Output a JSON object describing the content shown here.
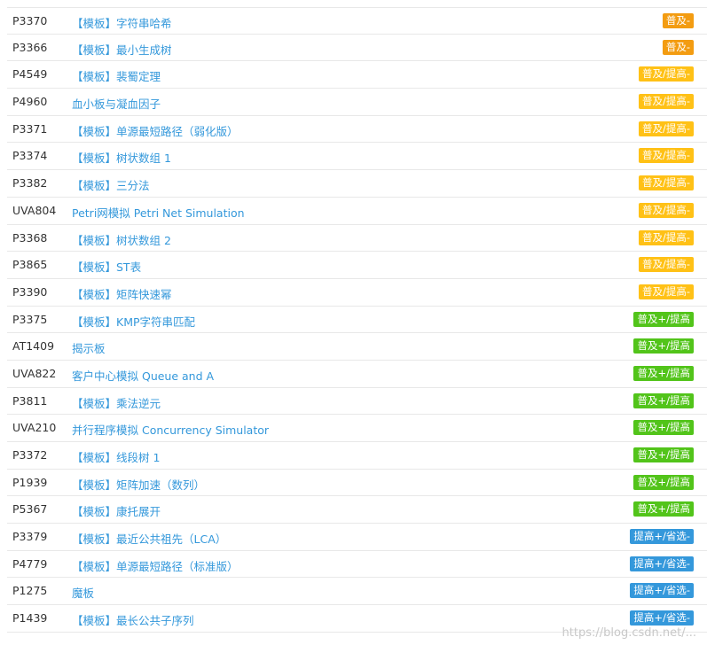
{
  "colors": {
    "level_orange": "#f39c11",
    "level_yellow": "#ffc116",
    "level_green": "#52c41a",
    "level_blue": "#3498db",
    "link": "#3498db"
  },
  "problems": [
    {
      "id": "P3370",
      "title": "【模板】字符串哈希",
      "level": "普及-",
      "color": "#f39c11"
    },
    {
      "id": "P3366",
      "title": "【模板】最小生成树",
      "level": "普及-",
      "color": "#f39c11"
    },
    {
      "id": "P4549",
      "title": "【模板】裴蜀定理",
      "level": "普及/提高-",
      "color": "#ffc116"
    },
    {
      "id": "P4960",
      "title": "血小板与凝血因子",
      "level": "普及/提高-",
      "color": "#ffc116"
    },
    {
      "id": "P3371",
      "title": "【模板】单源最短路径（弱化版）",
      "level": "普及/提高-",
      "color": "#ffc116"
    },
    {
      "id": "P3374",
      "title": "【模板】树状数组 1",
      "level": "普及/提高-",
      "color": "#ffc116"
    },
    {
      "id": "P3382",
      "title": "【模板】三分法",
      "level": "普及/提高-",
      "color": "#ffc116"
    },
    {
      "id": "UVA804",
      "title": "Petri网模拟 Petri Net Simulation",
      "level": "普及/提高-",
      "color": "#ffc116"
    },
    {
      "id": "P3368",
      "title": "【模板】树状数组 2",
      "level": "普及/提高-",
      "color": "#ffc116"
    },
    {
      "id": "P3865",
      "title": "【模板】ST表",
      "level": "普及/提高-",
      "color": "#ffc116"
    },
    {
      "id": "P3390",
      "title": "【模板】矩阵快速幂",
      "level": "普及/提高-",
      "color": "#ffc116"
    },
    {
      "id": "P3375",
      "title": "【模板】KMP字符串匹配",
      "level": "普及+/提高",
      "color": "#52c41a"
    },
    {
      "id": "AT1409",
      "title": "揭示板",
      "level": "普及+/提高",
      "color": "#52c41a"
    },
    {
      "id": "UVA822",
      "title": "客户中心模拟 Queue and A",
      "level": "普及+/提高",
      "color": "#52c41a"
    },
    {
      "id": "P3811",
      "title": "【模板】乘法逆元",
      "level": "普及+/提高",
      "color": "#52c41a"
    },
    {
      "id": "UVA210",
      "title": "并行程序模拟 Concurrency Simulator",
      "level": "普及+/提高",
      "color": "#52c41a"
    },
    {
      "id": "P3372",
      "title": "【模板】线段树 1",
      "level": "普及+/提高",
      "color": "#52c41a"
    },
    {
      "id": "P1939",
      "title": "【模板】矩阵加速（数列）",
      "level": "普及+/提高",
      "color": "#52c41a"
    },
    {
      "id": "P5367",
      "title": "【模板】康托展开",
      "level": "普及+/提高",
      "color": "#52c41a"
    },
    {
      "id": "P3379",
      "title": "【模板】最近公共祖先（LCA）",
      "level": "提高+/省选-",
      "color": "#3498db"
    },
    {
      "id": "P4779",
      "title": "【模板】单源最短路径（标准版）",
      "level": "提高+/省选-",
      "color": "#3498db"
    },
    {
      "id": "P1275",
      "title": "魔板",
      "level": "提高+/省选-",
      "color": "#3498db"
    },
    {
      "id": "P1439",
      "title": "【模板】最长公共子序列",
      "level": "提高+/省选-",
      "color": "#3498db"
    }
  ],
  "watermark": "https://blog.csdn.net/..."
}
